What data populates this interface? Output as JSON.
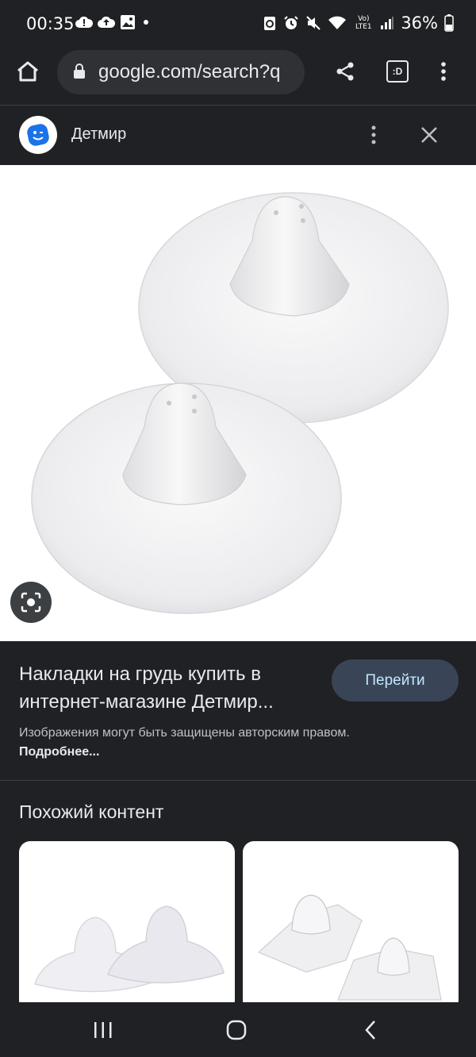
{
  "status_bar": {
    "time": "00:35",
    "battery": "36%",
    "network": "Vo) LTE1",
    "left_icons": [
      "cloud-alert-icon",
      "cloud-upload-icon",
      "image-icon",
      "dot-icon"
    ],
    "right_icons": [
      "recycle-icon",
      "alarm-icon",
      "mute-icon",
      "wifi-icon",
      "signal-icon",
      "battery-icon"
    ]
  },
  "browser": {
    "url": "google.com/search?q",
    "tab_count_label": ":D"
  },
  "source": {
    "name": "Детмир"
  },
  "result": {
    "title": "Накладки на грудь купить в интернет-магазине Детмир...",
    "go_label": "Перейти",
    "copyright_text": "Изображения могут быть защищены авторским правом.",
    "more_link": "Подробнее..."
  },
  "similar": {
    "heading": "Похожий контент"
  },
  "colors": {
    "background": "#202124",
    "button": "#394457",
    "button_text": "#c2e7ff",
    "logo": "#1a73e8"
  }
}
